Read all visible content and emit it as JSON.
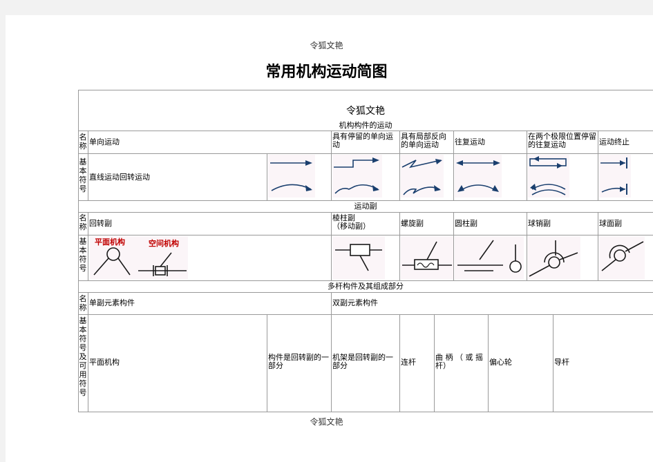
{
  "page": {
    "header": "令狐文艳",
    "title": "常用机构运动简图",
    "footer": "令狐文艳"
  },
  "table": {
    "inner_header": "令狐文艳",
    "section_motion": "机构构件的运动",
    "section_pair": "运动副",
    "section_multi": "多杆构件及其组成部分",
    "label_name": "名称",
    "label_symbol": "基本符号",
    "label_symbol_optional": "基本符号及可用符号",
    "motion": {
      "col_unidirectional": "单向运动",
      "col_dwell": "具有停留的单向运动",
      "col_partial_reverse": "具有局部反向的单向运动",
      "col_reciprocating": "往复运动",
      "col_dwell_reciprocating": "在两个极限位置停留的往复运动",
      "col_stop": "运动终止",
      "symbol_text": "直线运动回转运动"
    },
    "pair": {
      "col_revolute": "回转副",
      "col_prismatic": "棱柱副\n（移动副）",
      "col_screw": "螺旋副",
      "col_cylindrical": "圆柱副",
      "col_pin": "球销副",
      "col_spherical": "球面副",
      "planar_label": "平面机构",
      "spatial_label": "空间机构"
    },
    "multi": {
      "col_single": "单副元素构件",
      "col_double": "双副元素构件",
      "planar": "平面机构",
      "part_of_revolute": "构件是回转副的一部分",
      "frame_part": "机架是回转副的一部分",
      "link": "连杆",
      "crank": "曲 柄 （ 或 摇 杆）",
      "eccentric": "偏心轮",
      "guide": "导杆"
    }
  },
  "colors": {
    "border": "#999999",
    "image_bg": "#fbf5f8",
    "symbol_line": "#1a3f6e",
    "arrow_head": "#1a3f6e",
    "label_red": "#c00000"
  }
}
